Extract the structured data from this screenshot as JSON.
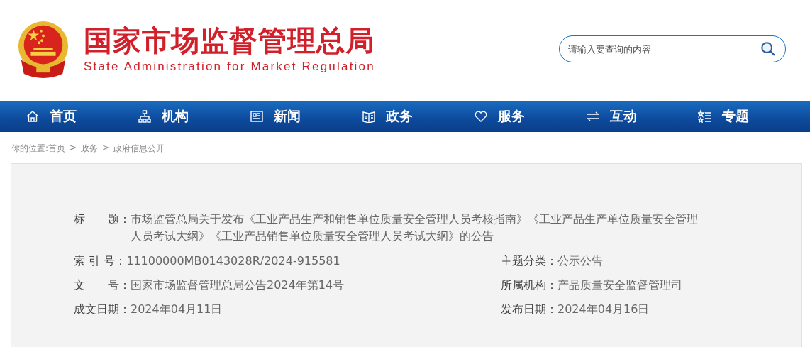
{
  "header": {
    "title": "国家市场监督管理总局",
    "subtitle": "State Administration for Market Regulation",
    "search": {
      "placeholder": "请输入要查询的内容"
    }
  },
  "nav": [
    {
      "label": "首页"
    },
    {
      "label": "机构"
    },
    {
      "label": "新闻"
    },
    {
      "label": "政务"
    },
    {
      "label": "服务"
    },
    {
      "label": "互动"
    },
    {
      "label": "专题"
    }
  ],
  "breadcrumb": {
    "prefix": "你的位置:",
    "links": [
      "首页",
      "政务",
      "政府信息公开"
    ],
    "separator": ">"
  },
  "meta": {
    "title": {
      "label": "标　　题：",
      "value": "市场监管总局关于发布《工业产品生产和销售单位质量安全管理人员考核指南》《工业产品生产单位质量安全管理人员考试大纲》《工业产品销售单位质量安全管理人员考试大纲》的公告"
    },
    "fields": [
      {
        "label": "索 引 号：",
        "value": "11100000MB0143028R/2024-915581"
      },
      {
        "label": "主题分类：",
        "value": "公示公告"
      },
      {
        "label": "文　　号：",
        "value": "国家市场监督管理总局公告2024年第14号"
      },
      {
        "label": "所属机构：",
        "value": "产品质量安全监督管理司"
      },
      {
        "label": "成文日期：",
        "value": "2024年04月11日"
      },
      {
        "label": "发布日期：",
        "value": "2024年04月16日"
      }
    ]
  }
}
